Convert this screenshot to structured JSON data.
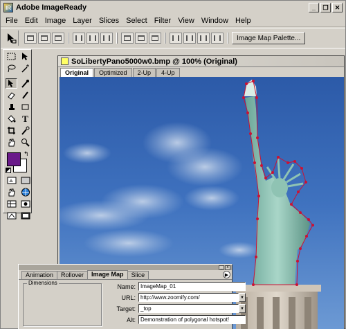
{
  "app": {
    "title": "Adobe ImageReady",
    "icon_text": "IR",
    "window_controls": [
      "minimize-icon",
      "restore-icon",
      "close-icon"
    ]
  },
  "menu": [
    "File",
    "Edit",
    "Image",
    "Layer",
    "Slices",
    "Select",
    "Filter",
    "View",
    "Window",
    "Help"
  ],
  "options_bar": {
    "palette_button": "Image Map Palette..."
  },
  "toolbox": {
    "foreground_color": "#6a1a8a",
    "background_color": "#ffffff"
  },
  "document": {
    "title": "SoLibertyPano5000w0.bmp @ 100% (Original)",
    "tabs": [
      "Original",
      "Optimized",
      "2-Up",
      "4-Up"
    ],
    "active_tab": "Original"
  },
  "panel": {
    "tabs": [
      "Animation",
      "Rollover",
      "Image Map",
      "Slice"
    ],
    "active_tab": "Image Map",
    "dimensions_label": "Dimensions",
    "name_label": "Name:",
    "name_value": "ImageMap_01",
    "url_label": "URL:",
    "url_value": "http://www.zoomify.com/",
    "target_label": "Target:",
    "target_value": "_top",
    "alt_label": "Alt:",
    "alt_value": "Demonstration of polygonal hotspot!"
  },
  "colors": {
    "hotspot": "#cc1133",
    "sky_top": "#2e5aa8",
    "statue": "#7fb8a8"
  }
}
